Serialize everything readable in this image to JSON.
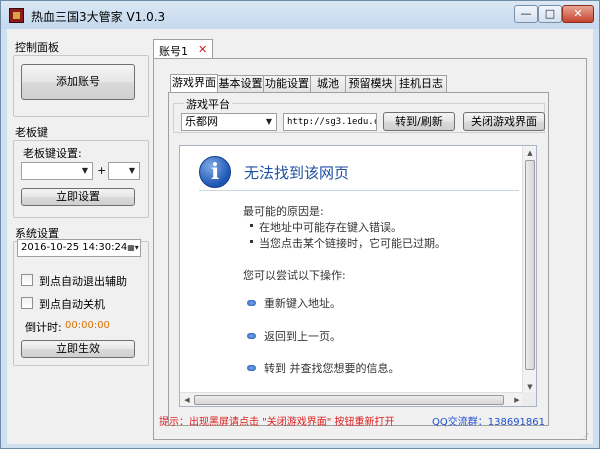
{
  "window": {
    "title": "热血三国3大管家 V1.0.3",
    "min_glyph": "—",
    "max_glyph": "□",
    "close_glyph": "✕"
  },
  "left": {
    "control_panel_title": "控制面板",
    "add_account_label": "添加账号",
    "boss_key_title": "老板键",
    "boss_key_setting_label": "老板键设置:",
    "boss_key_plus": "+",
    "set_now_label": "立即设置",
    "system_settings_title": "系统设置",
    "datetime_value": "2016-10-25 14:30:24",
    "auto_exit_label": "到点自动退出辅助",
    "auto_shutdown_label": "到点自动关机",
    "countdown_label": "倒计时:",
    "countdown_value": "00:00:00",
    "apply_now_label": "立即生效"
  },
  "account_tab": {
    "label": "账号1",
    "close_glyph": "✕"
  },
  "tabs": [
    "游戏界面",
    "基本设置",
    "功能设置",
    "城池",
    "预留模块",
    "挂机日志"
  ],
  "game": {
    "platform_group_title": "游戏平台",
    "platform_value": "乐都网",
    "url_value": "http://sg3.1edu.com",
    "goto_refresh_label": "转到/刷新",
    "close_game_label": "关闭游戏界面"
  },
  "browser": {
    "info_glyph": "i",
    "error_title": "无法找到该网页",
    "reason_heading": "最可能的原因是:",
    "reasons": [
      "在地址中可能存在键入错误。",
      "当您点击某个链接时，它可能已过期。"
    ],
    "try_heading": "您可以尝试以下操作:",
    "actions": [
      "重新键入地址。",
      "返回到上一页。",
      "转到 并查找您想要的信息。"
    ]
  },
  "footer": {
    "hint": "提示：出现黑屏请点击 \"关闭游戏界面\" 按钮重新打开",
    "qq_group": "QQ交流群：138691861"
  },
  "colors": {
    "hint_red": "#e02020",
    "qq_blue": "#1f4fd0",
    "countdown_orange": "#e07000",
    "error_title_blue": "#1f4fa0"
  }
}
